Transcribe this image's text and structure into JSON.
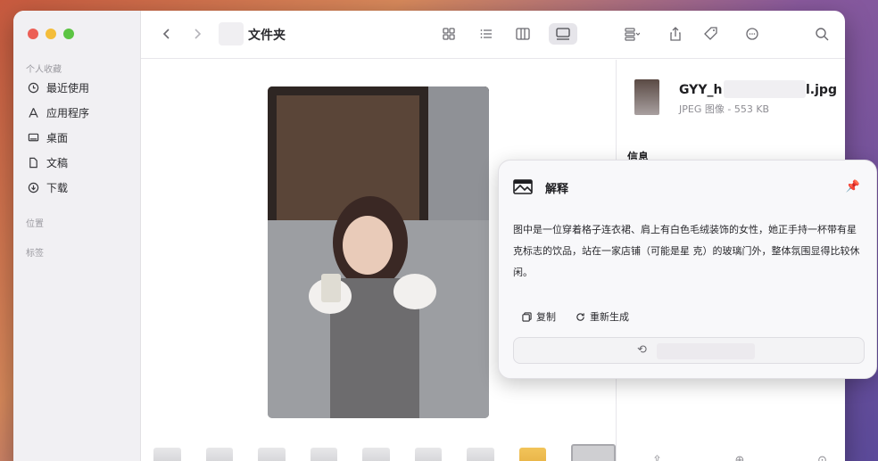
{
  "window": {
    "title": "文件夹"
  },
  "sidebar": {
    "section_favorites": "个人收藏",
    "items": [
      {
        "label": "最近使用",
        "icon": "clock-icon"
      },
      {
        "label": "应用程序",
        "icon": "apps-icon"
      },
      {
        "label": "桌面",
        "icon": "desktop-icon"
      },
      {
        "label": "文稿",
        "icon": "document-icon"
      },
      {
        "label": "下载",
        "icon": "download-icon"
      }
    ],
    "section_locations": "位置",
    "section_tags": "标签"
  },
  "inspector": {
    "filename_start": "GYY_h",
    "filename_end": "l.jpg",
    "file_type": "JPEG 图像",
    "file_size": "553 KB",
    "info_label": "信息"
  },
  "explain_panel": {
    "title": "解释",
    "body": "图中是一位穿着格子连衣裙、肩上有白色毛绒装饰的女性，她正手持一杯带有星  克标志的饮品，站在一家店铺（可能是星  克）的玻璃门外，整体氛围显得比较休闲。",
    "copy_label": "复制",
    "regenerate_label": "重新生成"
  },
  "colors": {
    "accent_red": "#ec5f56",
    "accent_yellow": "#f4bd3a",
    "accent_green": "#5cc443"
  }
}
